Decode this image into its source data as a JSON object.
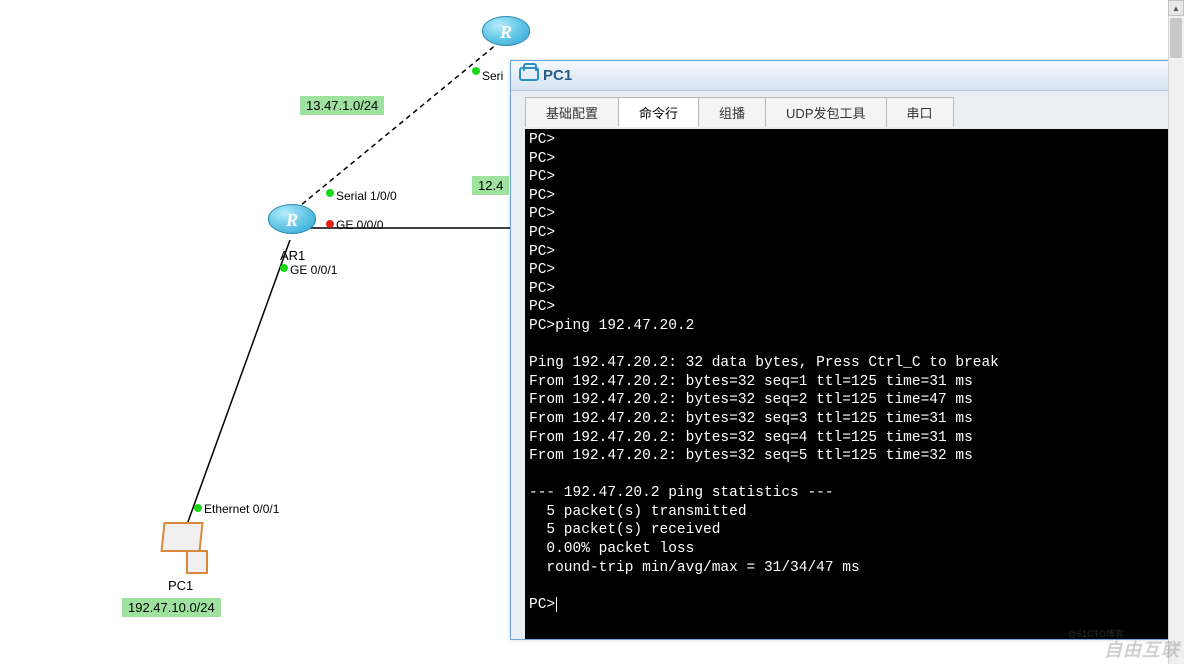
{
  "window": {
    "title": "PC1",
    "tabs": [
      {
        "label": "基础配置"
      },
      {
        "label": "命令行"
      },
      {
        "label": "组播"
      },
      {
        "label": "UDP发包工具"
      },
      {
        "label": "串口"
      }
    ]
  },
  "network": {
    "subnets": {
      "s1": "13.47.1.0/24",
      "s2": "12.4",
      "s3": "192.47.10.0/24"
    },
    "interfaces": {
      "ser_top": "Seri",
      "ser100": "Serial 1/0/0",
      "ge000": "GE 0/0/0",
      "ge001": "GE 0/0/1",
      "eth001": "Ethernet 0/0/1"
    },
    "devices": {
      "router_top": "R",
      "router_mid": "R",
      "ar1": "AR1",
      "pc1": "PC1"
    }
  },
  "terminal": {
    "lines": [
      "PC>",
      "PC>",
      "PC>",
      "PC>",
      "PC>",
      "PC>",
      "PC>",
      "PC>",
      "PC>",
      "PC>",
      "PC>ping 192.47.20.2",
      "",
      "Ping 192.47.20.2: 32 data bytes, Press Ctrl_C to break",
      "From 192.47.20.2: bytes=32 seq=1 ttl=125 time=31 ms",
      "From 192.47.20.2: bytes=32 seq=2 ttl=125 time=47 ms",
      "From 192.47.20.2: bytes=32 seq=3 ttl=125 time=31 ms",
      "From 192.47.20.2: bytes=32 seq=4 ttl=125 time=31 ms",
      "From 192.47.20.2: bytes=32 seq=5 ttl=125 time=32 ms",
      "",
      "--- 192.47.20.2 ping statistics ---",
      "  5 packet(s) transmitted",
      "  5 packet(s) received",
      "  0.00% packet loss",
      "  round-trip min/avg/max = 31/34/47 ms",
      "",
      "PC>"
    ]
  },
  "watermark": {
    "main": "自由互联",
    "sub": "@51CTO博客"
  }
}
